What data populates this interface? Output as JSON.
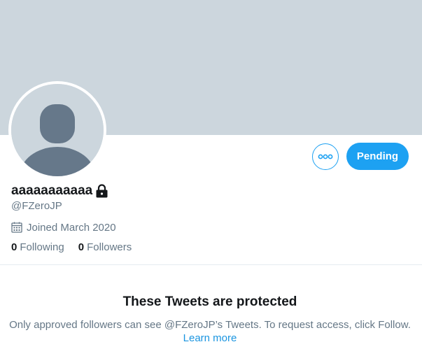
{
  "profile": {
    "display_name": "aaaaaaaaaaa",
    "handle": "@FZeroJP",
    "joined": "Joined March 2020",
    "following_count": "0",
    "following_label": "Following",
    "followers_count": "0",
    "followers_label": "Followers"
  },
  "actions": {
    "more_icon": "more-horizontal-icon",
    "pending_label": "Pending"
  },
  "protected": {
    "title": "These Tweets are protected",
    "description": "Only approved followers can see @FZeroJP’s Tweets. To request access, click Follow.",
    "learn_more": "Learn more"
  },
  "colors": {
    "banner": "#ccd6dd",
    "accent": "#1da1f2",
    "secondary_text": "#657786",
    "link": "#1b95e0"
  }
}
